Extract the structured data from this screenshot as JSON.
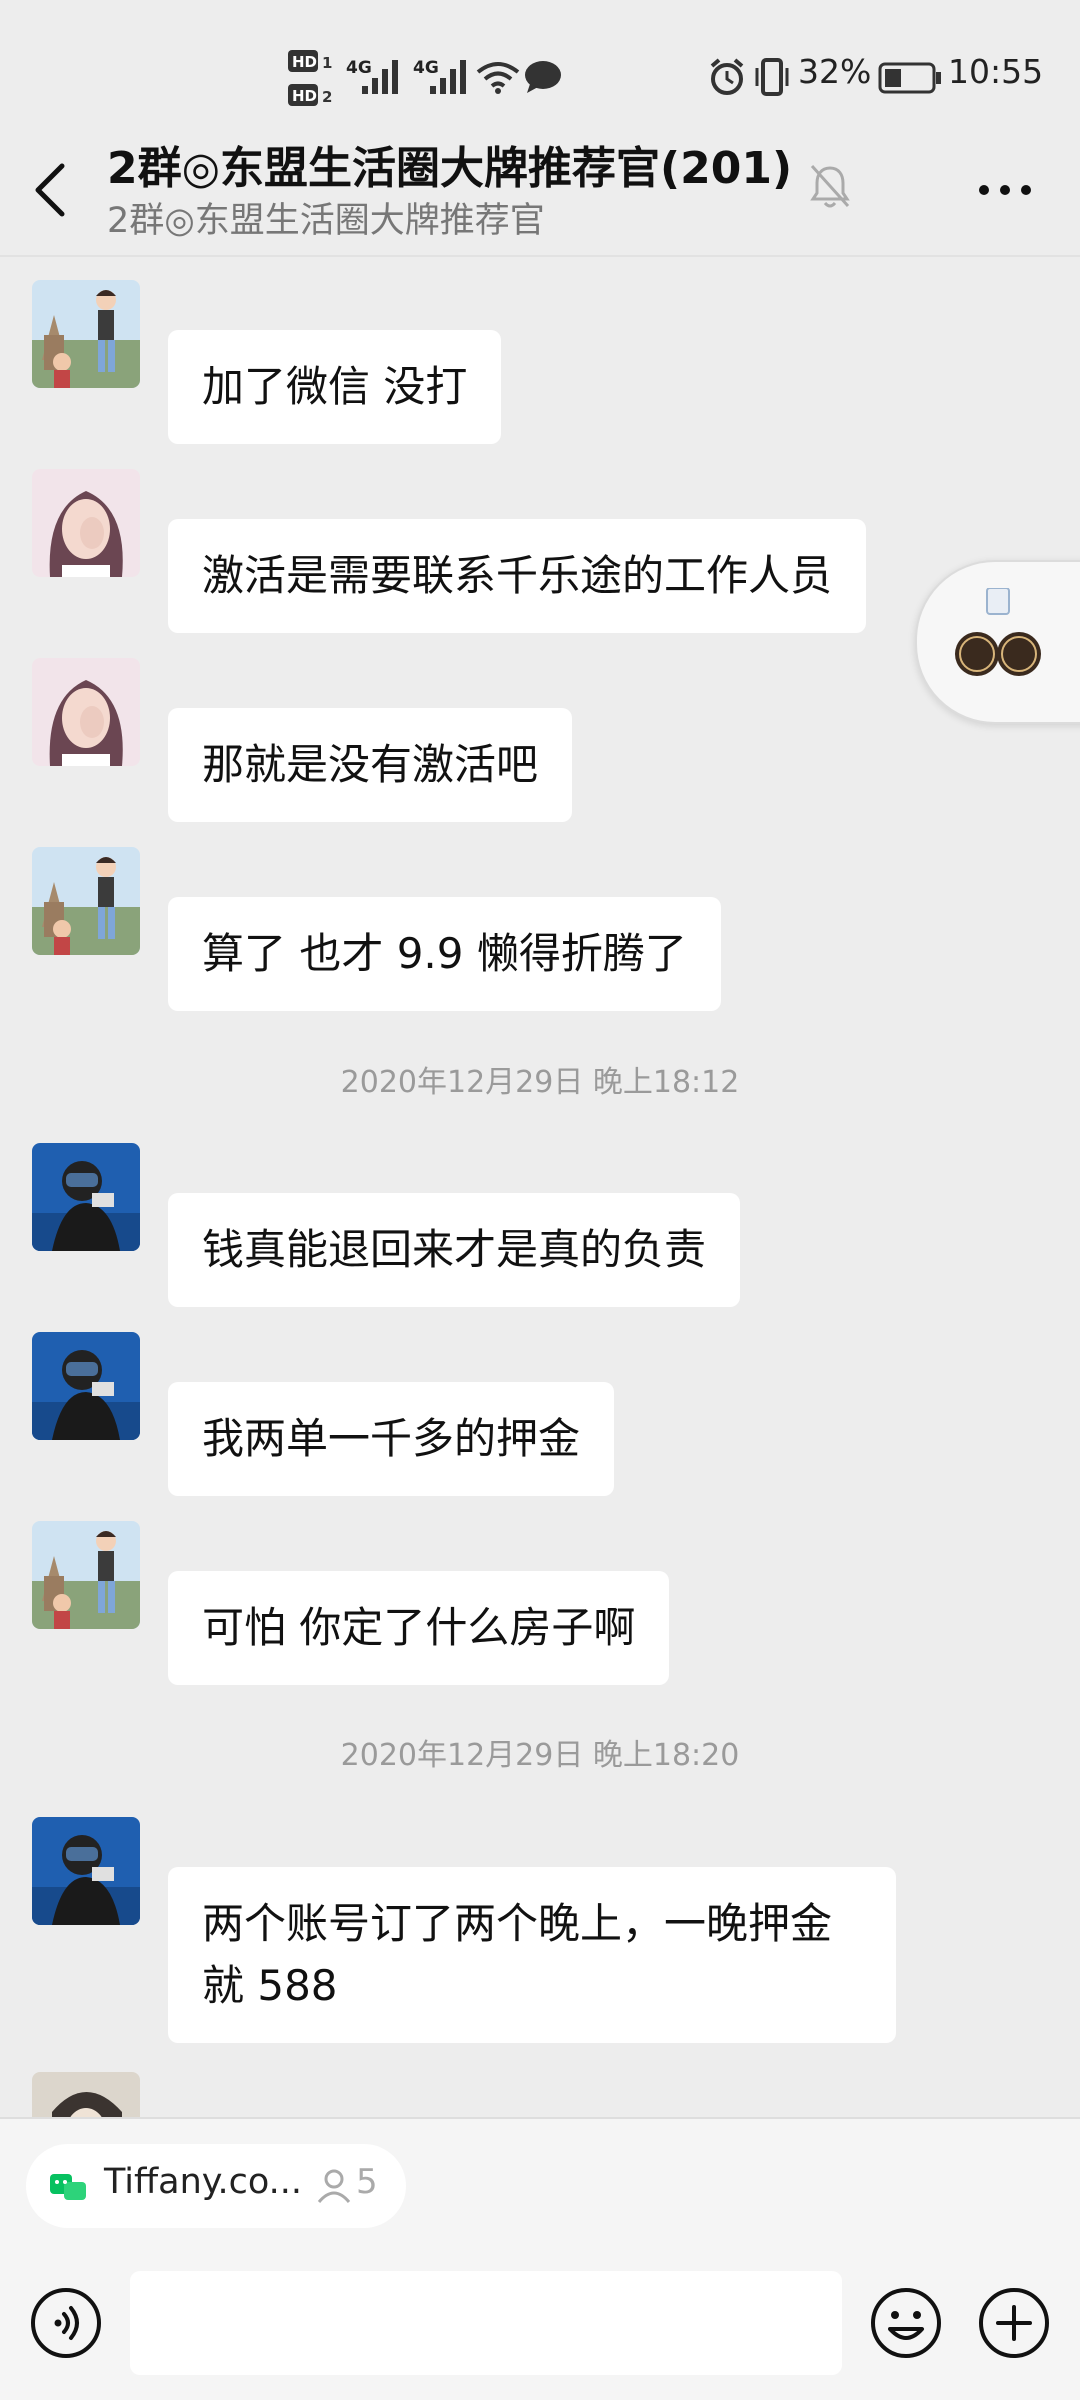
{
  "status_bar": {
    "hd1": "HD1",
    "hd2": "HD2",
    "net1": "4G",
    "net2": "4G",
    "battery_percent": "32%",
    "time": "10:55"
  },
  "header": {
    "title": "2群◎东盟生活圈大牌推荐官(201)",
    "subtitle": "2群◎东盟生活圈大牌推荐官"
  },
  "messages": [
    {
      "type": "message",
      "text": "加了微信 没打"
    },
    {
      "type": "message",
      "text": "激活是需要联系千乐途的工作人员"
    },
    {
      "type": "message",
      "text": "那就是没有激活吧"
    },
    {
      "type": "message",
      "text": "算了 也才 9.9 懒得折腾了"
    },
    {
      "type": "time",
      "text": "2020年12月29日 晚上18:12"
    },
    {
      "type": "message",
      "text": "钱真能退回来才是真的负责"
    },
    {
      "type": "message",
      "text": "我两单一千多的押金"
    },
    {
      "type": "message",
      "text": "可怕 你定了什么房子啊"
    },
    {
      "type": "time",
      "text": "2020年12月29日 晚上18:20"
    },
    {
      "type": "message",
      "text": "两个账号订了两个晚上，一晚押金就 588"
    }
  ],
  "mini_program": {
    "name": "Tiffany.co...",
    "count": "5"
  },
  "colors": {
    "background": "#ededed",
    "bubble": "#ffffff",
    "wechat_green": "#07c160"
  }
}
